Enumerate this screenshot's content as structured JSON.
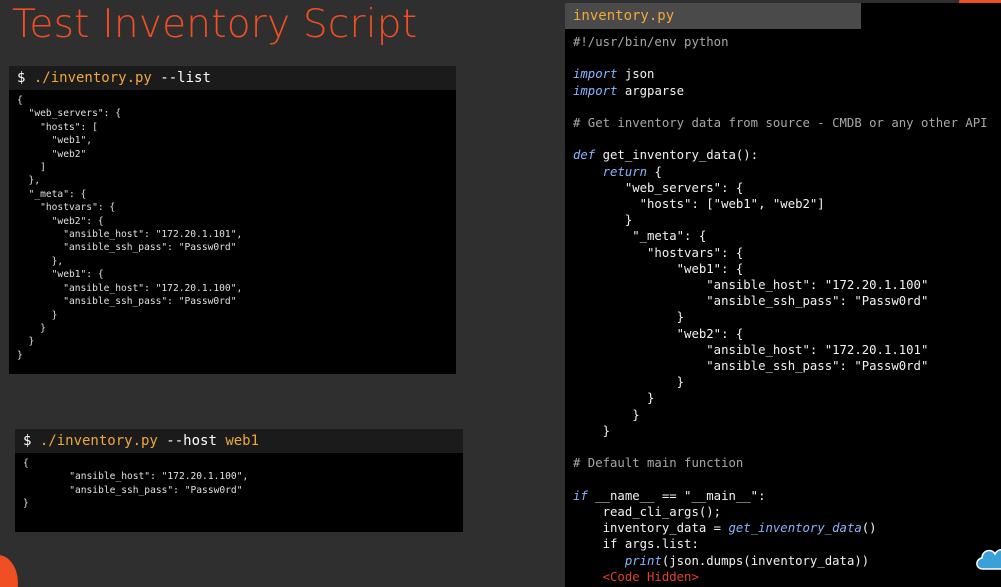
{
  "slide": {
    "title": "Test Inventory Script",
    "accent_color": "#f04e23"
  },
  "terminal_list": {
    "prompt": "$ ",
    "command": "./inventory.py",
    "args": " --list",
    "output_lines": [
      "{",
      "  \"web_servers\": {",
      "    \"hosts\": [",
      "      \"web1\",",
      "      \"web2\"",
      "    ]",
      "  },",
      "  \"_meta\": {",
      "    \"hostvars\": {",
      "      \"web2\": {",
      "        \"ansible_host\": \"172.20.1.101\",",
      "        \"ansible_ssh_pass\": \"Passw0rd\"",
      "      },",
      "      \"web1\": {",
      "        \"ansible_host\": \"172.20.1.100\",",
      "        \"ansible_ssh_pass\": \"Passw0rd\"",
      "      }",
      "    }",
      "  }",
      "}"
    ]
  },
  "terminal_host": {
    "prompt": "$ ",
    "command": "./inventory.py",
    "args": " --host ",
    "host": "web1",
    "output_lines": [
      "{",
      "        \"ansible_host\": \"172.20.1.100\",",
      "        \"ansible_ssh_pass\": \"Passw0rd\"",
      "}"
    ]
  },
  "editor": {
    "tab_label": "inventory.py",
    "code_lines": [
      {
        "cls": "c-comment",
        "text": "#!/usr/bin/env python"
      },
      {
        "cls": "",
        "text": ""
      },
      {
        "cls": "mix-import",
        "kw": "import",
        "rest": " json"
      },
      {
        "cls": "mix-import",
        "kw": "import",
        "rest": " argparse"
      },
      {
        "cls": "",
        "text": ""
      },
      {
        "cls": "c-comment",
        "text": "# Get inventory data from source - CMDB or any other API"
      },
      {
        "cls": "",
        "text": ""
      },
      {
        "cls": "mix-import",
        "kw": "def",
        "rest": " get_inventory_data():"
      },
      {
        "cls": "mix-indent",
        "kw": "    return",
        "rest": " {"
      },
      {
        "cls": "",
        "text": "       \"web_servers\": {"
      },
      {
        "cls": "",
        "text": "         \"hosts\": [\"web1\", \"web2\"]"
      },
      {
        "cls": "",
        "text": "       }"
      },
      {
        "cls": "",
        "text": "        \"_meta\": {"
      },
      {
        "cls": "",
        "text": "          \"hostvars\": {"
      },
      {
        "cls": "",
        "text": "              \"web1\": {"
      },
      {
        "cls": "",
        "text": "                  \"ansible_host\": \"172.20.1.100\""
      },
      {
        "cls": "",
        "text": "                  \"ansible_ssh_pass\": \"Passw0rd\""
      },
      {
        "cls": "",
        "text": "              }"
      },
      {
        "cls": "",
        "text": "              \"web2\": {"
      },
      {
        "cls": "",
        "text": "                  \"ansible_host\": \"172.20.1.101\""
      },
      {
        "cls": "",
        "text": "                  \"ansible_ssh_pass\": \"Passw0rd\""
      },
      {
        "cls": "",
        "text": "              }"
      },
      {
        "cls": "",
        "text": "          }"
      },
      {
        "cls": "",
        "text": "        }"
      },
      {
        "cls": "",
        "text": "    }"
      },
      {
        "cls": "",
        "text": ""
      },
      {
        "cls": "c-comment",
        "text": "# Default main function"
      },
      {
        "cls": "",
        "text": ""
      },
      {
        "cls": "mix-import",
        "kw": "if",
        "rest": " __name__ == \"__main__\":"
      },
      {
        "cls": "",
        "text": "    read_cli_args();"
      },
      {
        "cls": "mix-call",
        "pre": "    inventory_data = ",
        "call": "get_inventory_data",
        "post": "()"
      },
      {
        "cls": "",
        "text": "    if args.list:"
      },
      {
        "cls": "mix-call",
        "pre": "       ",
        "call": "print",
        "post": "(json.dumps(inventory_data))"
      },
      {
        "cls": "c-hidden",
        "text": "    <Code Hidden>"
      }
    ]
  }
}
